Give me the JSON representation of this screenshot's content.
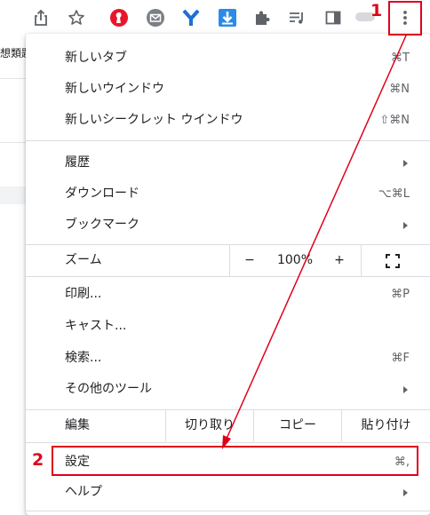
{
  "behind_page": {
    "text": "想類題"
  },
  "menu": {
    "items": [
      {
        "label": "新しいタブ",
        "shortcut": "⌘T"
      },
      {
        "label": "新しいウインドウ",
        "shortcut": "⌘N"
      },
      {
        "label": "新しいシークレット ウインドウ",
        "shortcut": "⇧⌘N"
      },
      {
        "label": "履歴"
      },
      {
        "label": "ダウンロード",
        "shortcut": "⌥⌘L"
      },
      {
        "label": "ブックマーク"
      },
      {
        "label": "印刷...",
        "shortcut": "⌘P"
      },
      {
        "label": "キャスト..."
      },
      {
        "label": "検索...",
        "shortcut": "⌘F"
      },
      {
        "label": "その他のツール"
      },
      {
        "label": "設定",
        "shortcut": "⌘,"
      },
      {
        "label": "ヘルプ"
      }
    ],
    "zoom": {
      "label": "ズーム",
      "minus": "−",
      "value": "100%",
      "plus": "+"
    },
    "edit": {
      "label": "編集",
      "cut": "切り取り",
      "copy": "コピー",
      "paste": "貼り付け"
    }
  },
  "annotations": {
    "step1": "1",
    "step2": "2",
    "color": "#e0001b"
  },
  "icons": {
    "toolbar": [
      "share-icon",
      "bookmark-star-icon",
      "extension-red-icon",
      "extension-mail-icon",
      "extension-y-icon",
      "extension-download-icon",
      "extensions-puzzle-icon",
      "reading-list-icon",
      "side-panel-icon",
      "profile-avatar",
      "more-menu-icon"
    ],
    "zoom_fullscreen": "fullscreen-icon"
  }
}
